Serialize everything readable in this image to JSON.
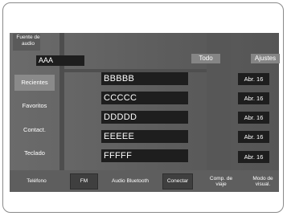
{
  "source": {
    "label": "Fuente de audio",
    "value": "AAA"
  },
  "top_buttons": {
    "all": "Todo",
    "settings": "Ajustes"
  },
  "side_menu": [
    "Recientes",
    "Favoritos",
    "Contact.",
    "Teclado"
  ],
  "list": [
    {
      "name": "BBBBB",
      "date": "Abr. 16"
    },
    {
      "name": "CCCCC",
      "date": "Abr. 16"
    },
    {
      "name": "DDDDD",
      "date": "Abr. 16"
    },
    {
      "name": "EEEEE",
      "date": "Abr. 16"
    },
    {
      "name": "FFFFF",
      "date": "Abr. 16"
    }
  ],
  "bottom": {
    "phone": "Teléfono",
    "fm": "FM",
    "bt_audio": "Audio Bluetooth",
    "connect": "Conectar",
    "trip": "Comp. de viaje",
    "display": "Modo de visual."
  }
}
